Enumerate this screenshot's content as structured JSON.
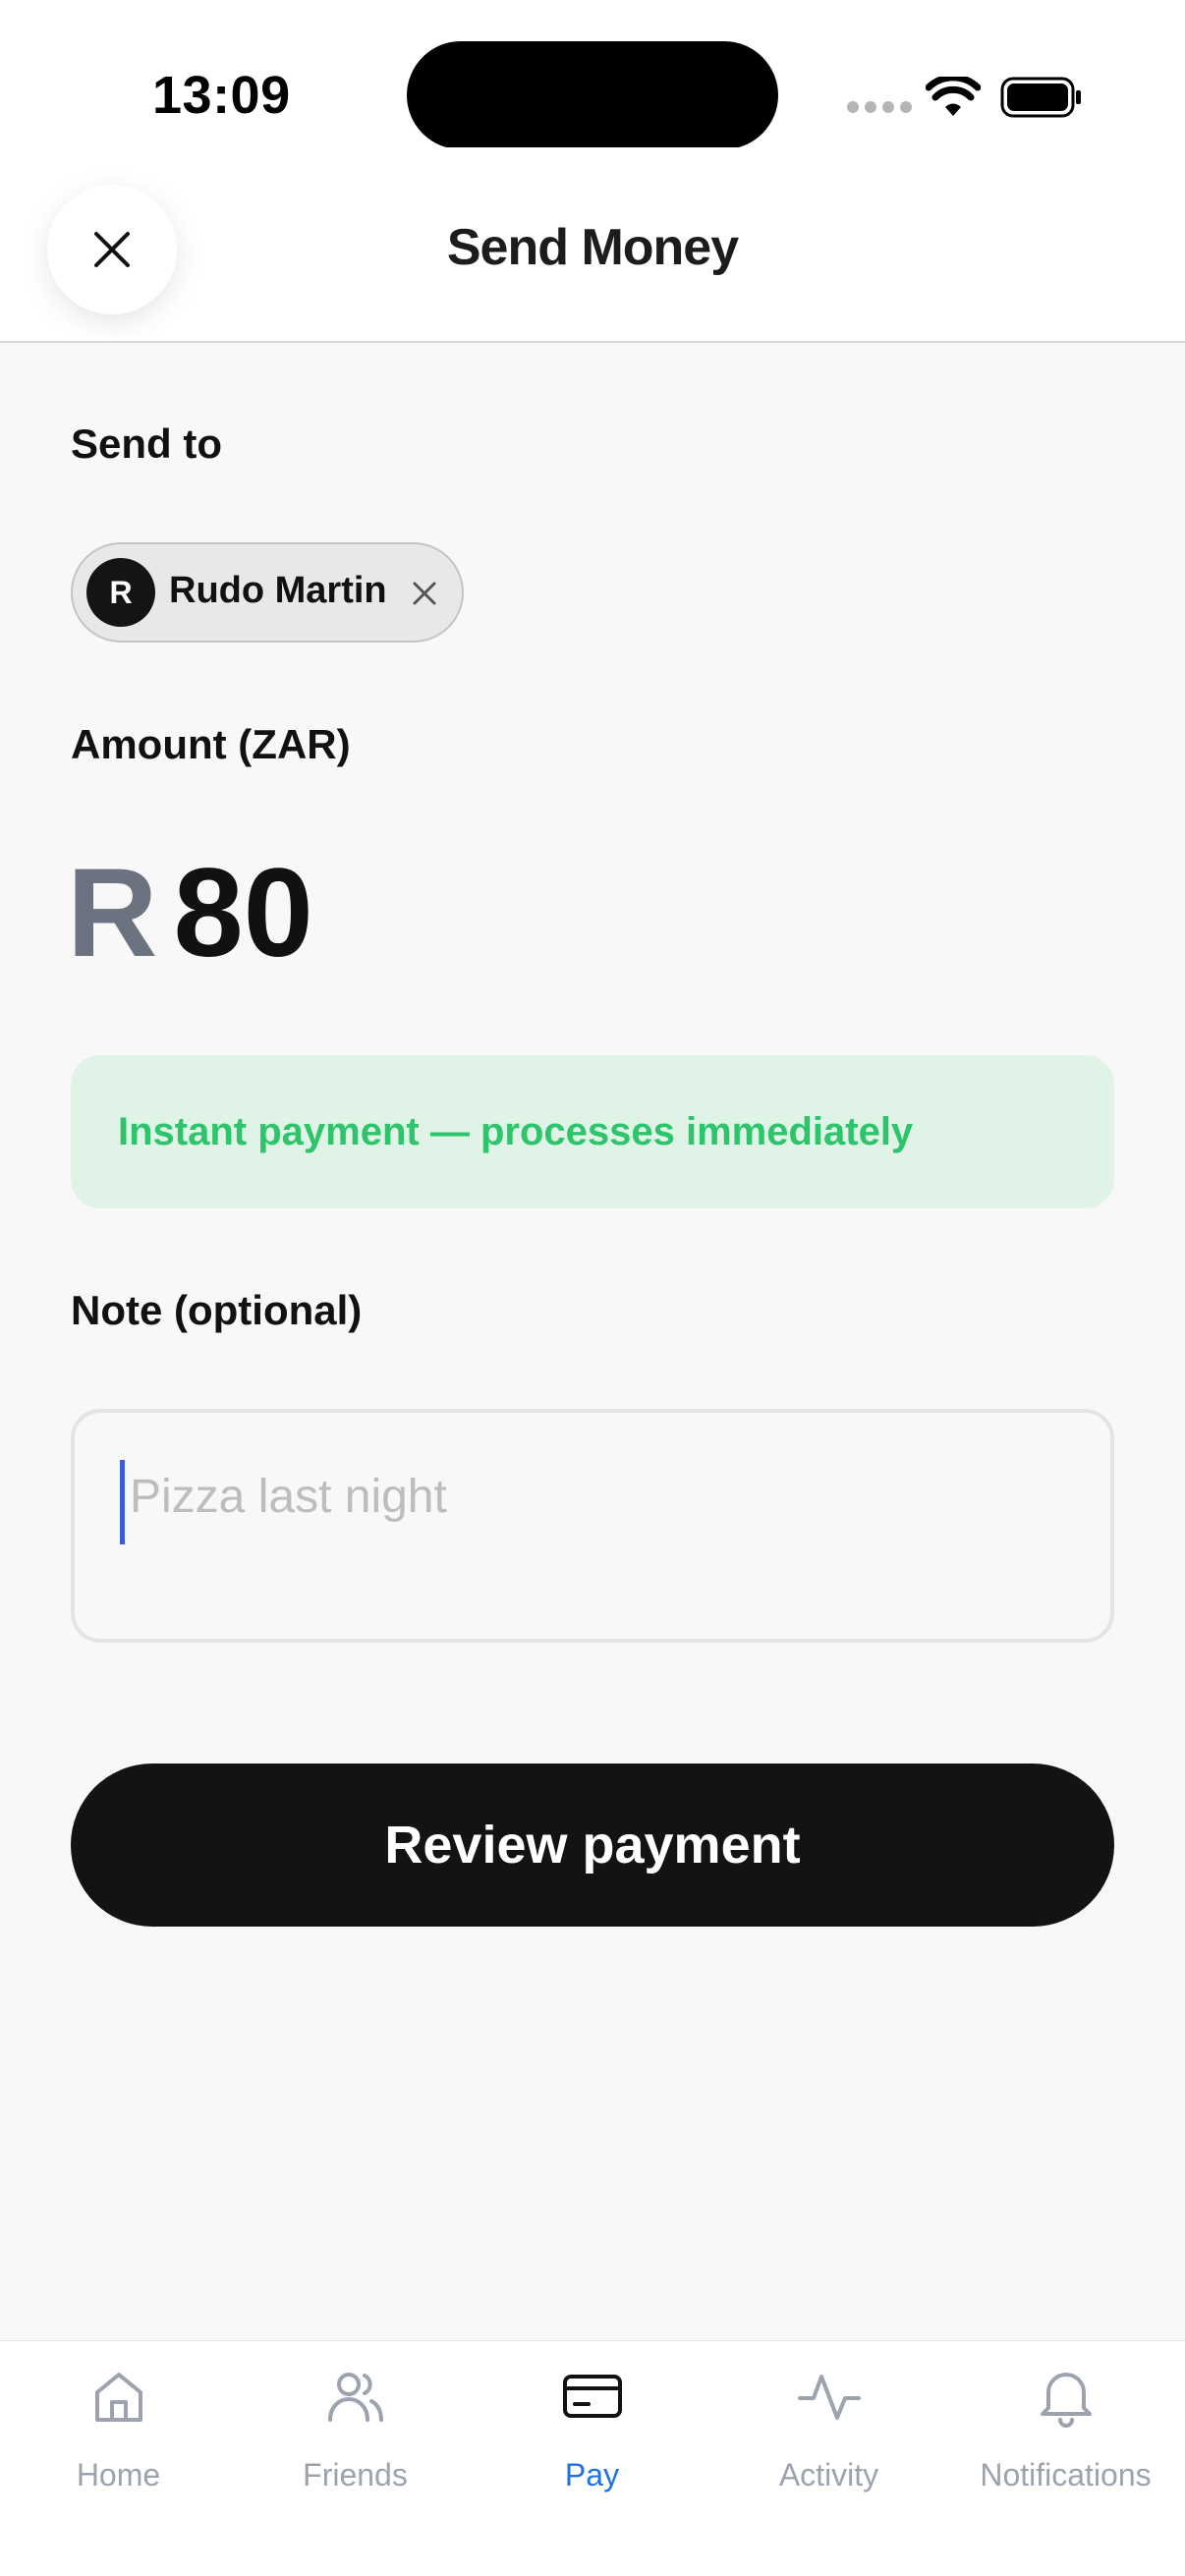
{
  "status_bar": {
    "time": "13:09"
  },
  "header": {
    "title": "Send Money"
  },
  "send_to": {
    "label": "Send to",
    "recipient": {
      "initial": "R",
      "name": "Rudo Martin"
    }
  },
  "amount": {
    "label": "Amount (ZAR)",
    "currency_symbol": "R",
    "value": "80"
  },
  "notice": {
    "text": "Instant payment — processes immediately"
  },
  "note": {
    "label": "Note (optional)",
    "placeholder": "Pizza last night"
  },
  "review_button": {
    "label": "Review payment"
  },
  "tab_bar": {
    "tabs": [
      {
        "label": "Home",
        "icon": "home-icon"
      },
      {
        "label": "Friends",
        "icon": "friends-icon"
      },
      {
        "label": "Pay",
        "icon": "card-icon",
        "active": true
      },
      {
        "label": "Activity",
        "icon": "activity-icon"
      },
      {
        "label": "Notifications",
        "icon": "bell-icon"
      }
    ]
  },
  "colors": {
    "accent": "#1d72e8",
    "success": "#2ec46b",
    "success_bg": "#dff3e6",
    "primary_button": "#131313"
  }
}
